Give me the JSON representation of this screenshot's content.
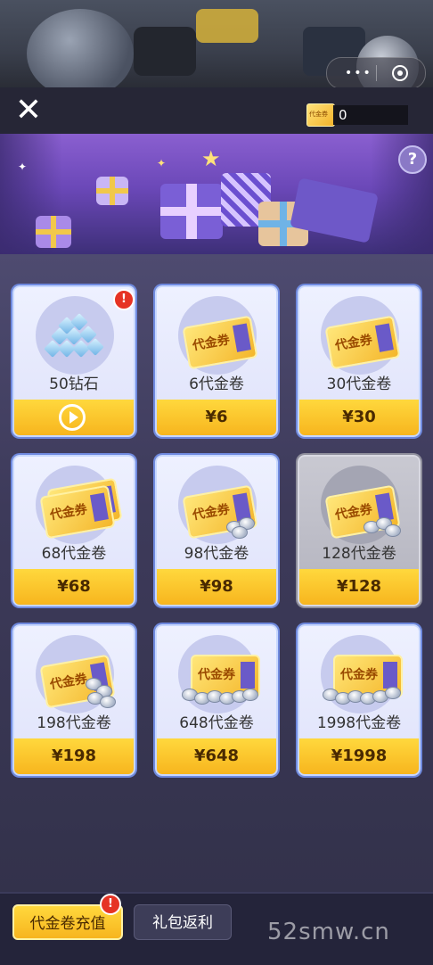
{
  "header": {
    "close_icon": "close-icon",
    "balance_ticket_label": "代金券",
    "balance_value": "0"
  },
  "banner": {
    "help_label": "?"
  },
  "cards": [
    {
      "name": "50钻石",
      "price": "",
      "badge": "!",
      "art": "diamonds",
      "action_icon": "play-icon"
    },
    {
      "name": "6代金卷",
      "price": "¥6",
      "art": "voucher-1"
    },
    {
      "name": "30代金卷",
      "price": "¥30",
      "art": "voucher-1"
    },
    {
      "name": "68代金卷",
      "price": "¥68",
      "art": "voucher-2"
    },
    {
      "name": "98代金卷",
      "price": "¥98",
      "art": "voucher-coins"
    },
    {
      "name": "128代金卷",
      "price": "¥128",
      "art": "voucher-coins",
      "dim": true
    },
    {
      "name": "198代金卷",
      "price": "¥198",
      "art": "voucher-coins"
    },
    {
      "name": "648代金卷",
      "price": "¥648",
      "art": "voucher-many"
    },
    {
      "name": "1998代金卷",
      "price": "¥1998",
      "art": "voucher-many"
    }
  ],
  "voucher_label": "代金券",
  "tabs": [
    {
      "label": "代金卷充值",
      "active": true,
      "badge": "!"
    },
    {
      "label": "礼包返利",
      "active": false
    }
  ],
  "watermark": "52smw.cn",
  "colors": {
    "price_yellow": "#f7b51e",
    "badge_red": "#e63324",
    "card_border": "#6f8adf"
  }
}
